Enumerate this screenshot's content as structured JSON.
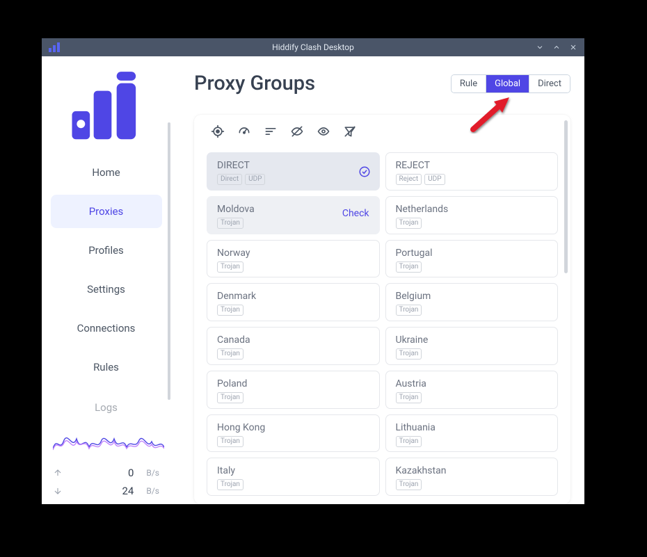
{
  "window": {
    "title": "Hiddify Clash Desktop"
  },
  "sidebar": {
    "items": [
      "Home",
      "Proxies",
      "Profiles",
      "Settings",
      "Connections",
      "Rules",
      "Logs"
    ],
    "active_index": 1
  },
  "stats": {
    "up": {
      "value": "0",
      "unit": "B/s"
    },
    "down": {
      "value": "24",
      "unit": "B/s"
    }
  },
  "header": {
    "title": "Proxy Groups",
    "segments": [
      "Rule",
      "Global",
      "Direct"
    ],
    "active_segment": 1
  },
  "toolbar_icons": [
    "locate-icon",
    "speed-icon",
    "sort-icon",
    "hidden-icon",
    "eye-icon",
    "filter-off-icon"
  ],
  "proxies": [
    {
      "name": "DIRECT",
      "tags": [
        "Direct",
        "UDP"
      ],
      "selected": true,
      "badge": "check"
    },
    {
      "name": "REJECT",
      "tags": [
        "Reject",
        "UDP"
      ]
    },
    {
      "name": "Moldova",
      "tags": [
        "Trojan"
      ],
      "hover": true,
      "action": "Check"
    },
    {
      "name": "Netherlands",
      "tags": [
        "Trojan"
      ]
    },
    {
      "name": "Norway",
      "tags": [
        "Trojan"
      ]
    },
    {
      "name": "Portugal",
      "tags": [
        "Trojan"
      ]
    },
    {
      "name": "Denmark",
      "tags": [
        "Trojan"
      ]
    },
    {
      "name": "Belgium",
      "tags": [
        "Trojan"
      ]
    },
    {
      "name": "Canada",
      "tags": [
        "Trojan"
      ]
    },
    {
      "name": "Ukraine",
      "tags": [
        "Trojan"
      ]
    },
    {
      "name": "Poland",
      "tags": [
        "Trojan"
      ]
    },
    {
      "name": "Austria",
      "tags": [
        "Trojan"
      ]
    },
    {
      "name": "Hong Kong",
      "tags": [
        "Trojan"
      ]
    },
    {
      "name": "Lithuania",
      "tags": [
        "Trojan"
      ]
    },
    {
      "name": "Italy",
      "tags": [
        "Trojan"
      ]
    },
    {
      "name": "Kazakhstan",
      "tags": [
        "Trojan"
      ]
    }
  ],
  "colors": {
    "accent": "#4f46e5"
  }
}
